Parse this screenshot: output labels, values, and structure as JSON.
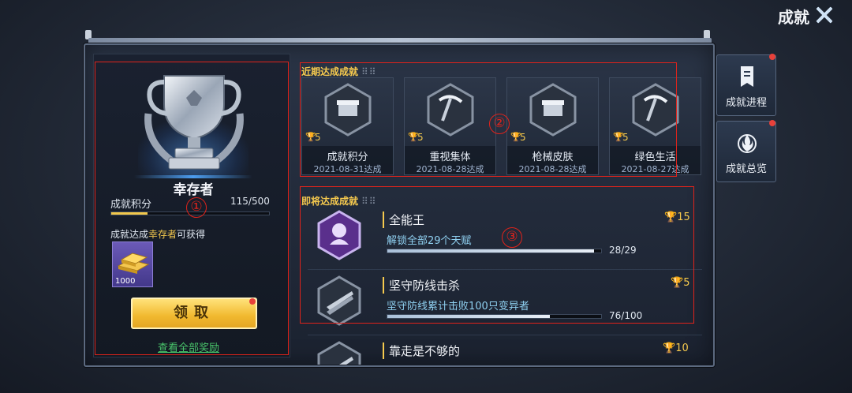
{
  "header": {
    "title": "成就"
  },
  "left_panel": {
    "rank_name": "幸存者",
    "score_label": "成就积分",
    "score_value": "115/500",
    "score_progress": 0.23,
    "reward_note_prefix": "成就达成",
    "reward_note_highlight": "幸存者",
    "reward_note_suffix": "可获得",
    "reward_item_count": "1000",
    "claim_button": "领取",
    "view_all_link": "查看全部奖励"
  },
  "recent": {
    "title": "近期达成成就",
    "items": [
      {
        "name": "成就积分",
        "date": "2021-08-31达成",
        "points": "5",
        "icon": "box-icon"
      },
      {
        "name": "重视集体",
        "date": "2021-08-28达成",
        "points": "5",
        "icon": "pickaxe-icon"
      },
      {
        "name": "枪械皮肤",
        "date": "2021-08-28达成",
        "points": "5",
        "icon": "box-icon"
      },
      {
        "name": "绿色生活",
        "date": "2021-08-27达成",
        "points": "5",
        "icon": "pickaxe-icon"
      }
    ]
  },
  "upcoming": {
    "title": "即将达成成就",
    "items": [
      {
        "name": "全能王",
        "desc": "解锁全部29个天赋",
        "progress_text": "28/29",
        "progress": 0.9655,
        "points": "15",
        "icon": "talent-icon"
      },
      {
        "name": "坚守防线击杀",
        "desc": "坚守防线累计击败100只变异者",
        "progress_text": "76/100",
        "progress": 0.76,
        "points": "5",
        "icon": "rifle-icon"
      },
      {
        "name": "靠走是不够的",
        "desc": "",
        "progress_text": "",
        "progress": 0,
        "points": "10",
        "icon": "rifle-icon"
      }
    ]
  },
  "side_tabs": [
    {
      "label": "成就进程",
      "icon": "scroll-icon"
    },
    {
      "label": "成就总览",
      "icon": "flame-emblem-icon"
    }
  ],
  "annotations": [
    "①",
    "②",
    "③"
  ],
  "colors": {
    "gold": "#f5c94e",
    "accent_blue": "#4c9df0",
    "annotation_red": "#e0231b",
    "link_green": "#49c46b"
  }
}
